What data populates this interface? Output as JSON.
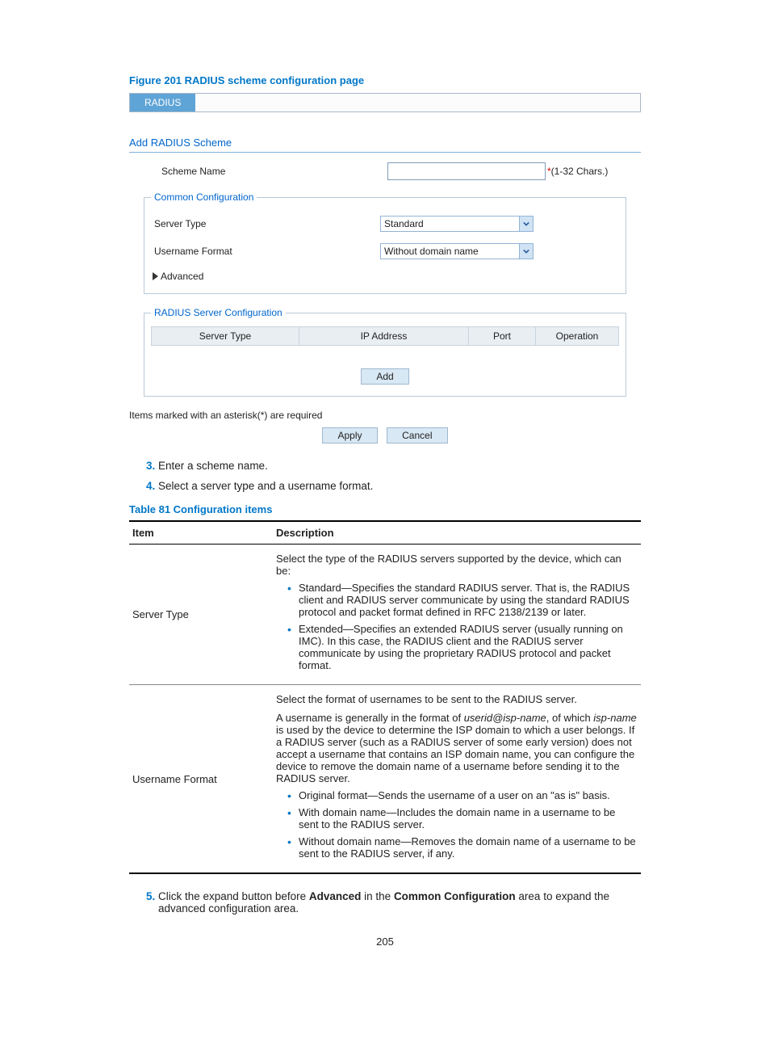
{
  "figure_caption": "Figure 201 RADIUS scheme configuration page",
  "tab_label": "RADIUS",
  "form": {
    "title": "Add RADIUS Scheme",
    "scheme_name_label": "Scheme Name",
    "scheme_name_hint": "(1-32 Chars.)",
    "scheme_name_asterisk": "*",
    "common_legend": "Common Configuration",
    "server_type_label": "Server Type",
    "server_type_value": "Standard",
    "username_format_label": "Username Format",
    "username_format_value": "Without domain name",
    "advanced_label": "Advanced",
    "radius_legend": "RADIUS Server Configuration",
    "grid": {
      "server_type": "Server Type",
      "ip_address": "IP Address",
      "port": "Port",
      "operation": "Operation"
    },
    "add_btn": "Add",
    "required_note": "Items marked with an asterisk(*) are required",
    "apply_btn": "Apply",
    "cancel_btn": "Cancel"
  },
  "steps": {
    "s3": "Enter a scheme name.",
    "s4": "Select a server type and a username format.",
    "s5_pre": "Click the expand button before ",
    "s5_b1": "Advanced",
    "s5_mid": " in the ",
    "s5_b2": "Common Configuration",
    "s5_post": " area to expand the advanced configuration area."
  },
  "table_caption": "Table 81 Configuration items",
  "table": {
    "head_item": "Item",
    "head_desc": "Description",
    "r1_item": "Server Type",
    "r1_intro": "Select the type of the RADIUS servers supported by the device, which can be:",
    "r1_b1": "Standard—Specifies the standard RADIUS server. That is, the RADIUS client and RADIUS server communicate by using the standard RADIUS protocol and packet format defined in RFC 2138/2139 or later.",
    "r1_b2": "Extended—Specifies an extended RADIUS server (usually running on IMC). In this case, the RADIUS client and the RADIUS server communicate by using the proprietary RADIUS protocol and packet format.",
    "r2_item": "Username Format",
    "r2_p1": "Select the format of usernames to be sent to the RADIUS server.",
    "r2_p2_pre": "A username is generally in the format of ",
    "r2_p2_em1": "userid@isp-name",
    "r2_p2_mid": ", of which ",
    "r2_p2_em2": "isp-name",
    "r2_p2_post": " is used by the device to determine the ISP domain to which a user belongs. If a RADIUS server (such as a RADIUS server of some early version) does not accept a username that contains an ISP domain name, you can configure the device to remove the domain name of a username before sending it to the RADIUS server.",
    "r2_b1": "Original format—Sends the username of a user on an \"as is\" basis.",
    "r2_b2": "With domain name—Includes the domain name in a username to be sent to the RADIUS server.",
    "r2_b3": "Without domain name—Removes the domain name of a username to be sent to the RADIUS server, if any."
  },
  "page_number": "205"
}
